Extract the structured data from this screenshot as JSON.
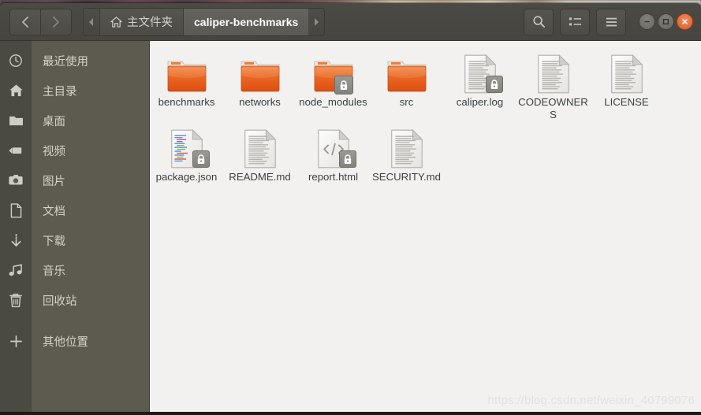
{
  "window": {
    "title": "caliper-benchmarks",
    "controls": {
      "minimize_label": "−",
      "maximize_label": "▣",
      "close_label": "×"
    }
  },
  "nav": {
    "back_label": "‹",
    "forward_label": "›"
  },
  "breadcrumb": {
    "left_arrow": "◂",
    "right_arrow": "▸",
    "items": [
      {
        "label": "主文件夹",
        "icon": "home-icon",
        "active": false
      },
      {
        "label": "caliper-benchmarks",
        "icon": "",
        "active": true
      }
    ]
  },
  "toolbar": {
    "search_label": "search-icon",
    "view_toggle_label": "list-view-icon",
    "menu_label": "hamburger-menu-icon"
  },
  "sidebar": {
    "items": [
      {
        "label": "最近使用",
        "icon": "clock-icon"
      },
      {
        "label": "主目录",
        "icon": "home-icon"
      },
      {
        "label": "桌面",
        "icon": "folder-icon"
      },
      {
        "label": "视频",
        "icon": "video-camera-icon"
      },
      {
        "label": "图片",
        "icon": "camera-icon"
      },
      {
        "label": "文档",
        "icon": "document-icon"
      },
      {
        "label": "下载",
        "icon": "download-arrow-icon"
      },
      {
        "label": "音乐",
        "icon": "music-note-icon"
      },
      {
        "label": "回收站",
        "icon": "trash-icon"
      }
    ],
    "other_locations": {
      "label": "其他位置",
      "icon": "plus-icon"
    }
  },
  "files": [
    {
      "name": "benchmarks",
      "type": "folder",
      "locked": false
    },
    {
      "name": "networks",
      "type": "folder",
      "locked": false
    },
    {
      "name": "node_modules",
      "type": "folder",
      "locked": true
    },
    {
      "name": "src",
      "type": "folder",
      "locked": false
    },
    {
      "name": "caliper.log",
      "type": "document",
      "locked": true
    },
    {
      "name": "CODEOWNERS",
      "type": "document",
      "locked": false
    },
    {
      "name": "LICENSE",
      "type": "document",
      "locked": false
    },
    {
      "name": "package.json",
      "type": "code-json",
      "locked": true
    },
    {
      "name": "README.md",
      "type": "document",
      "locked": false
    },
    {
      "name": "report.html",
      "type": "code-html",
      "locked": true
    },
    {
      "name": "SECURITY.md",
      "type": "document",
      "locked": false
    }
  ],
  "watermark": {
    "text": "https://blog.csdn.net/weixin_40799076"
  },
  "colors": {
    "headerbar": "#4b4a44",
    "sidebar_icons": "#4a4942",
    "sidebar_labels": "#5d5b50",
    "content_bg": "#f2f1ef",
    "folder_orange": "#e8601f",
    "close_button": "#e05a28",
    "file_text": "#3b4044"
  }
}
